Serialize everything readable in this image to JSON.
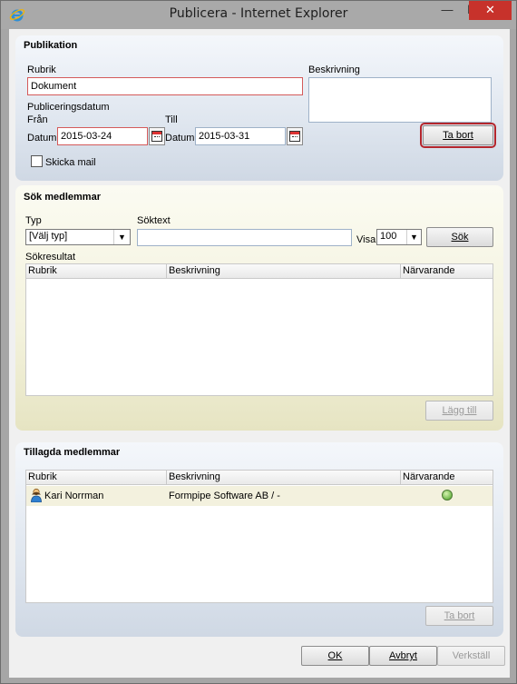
{
  "window": {
    "title": "Publicera - Internet Explorer",
    "min_glyph": "—",
    "max_glyph": "☐",
    "close_glyph": "✕"
  },
  "publikation": {
    "title": "Publikation",
    "rubrik_label": "Rubrik",
    "rubrik_value": "Dokument",
    "beskrivning_label": "Beskrivning",
    "beskrivning_value": "",
    "publiceringsdatum_label": "Publiceringsdatum",
    "fran_label": "Från",
    "till_label": "Till",
    "datum_label": "Datum",
    "fran_value": "2015-03-24",
    "till_value": "2015-03-31",
    "ta_bort_label": "Ta bort",
    "skicka_mail_label": "Skicka mail",
    "skicka_mail_checked": false
  },
  "sok": {
    "title": "Sök medlemmar",
    "typ_label": "Typ",
    "typ_selected": "[Välj typ]",
    "soktext_label": "Söktext",
    "soktext_value": "",
    "visa_label": "Visa",
    "visa_selected": "100",
    "sok_button": "Sök",
    "sokresultat_label": "Sökresultat",
    "columns": [
      "Rubrik",
      "Beskrivning",
      "Närvarande"
    ],
    "lagg_till_button": "Lägg till"
  },
  "tillagda": {
    "title": "Tillagda medlemmar",
    "columns": [
      "Rubrik",
      "Beskrivning",
      "Närvarande"
    ],
    "rows": [
      {
        "rubrik": "Kari Norrman",
        "beskrivning": "Formpipe Software AB / -",
        "narvarande": "green"
      }
    ],
    "ta_bort_button": "Ta bort"
  },
  "footer": {
    "ok": "OK",
    "avbryt": "Avbryt",
    "verkstall": "Verkställ"
  }
}
